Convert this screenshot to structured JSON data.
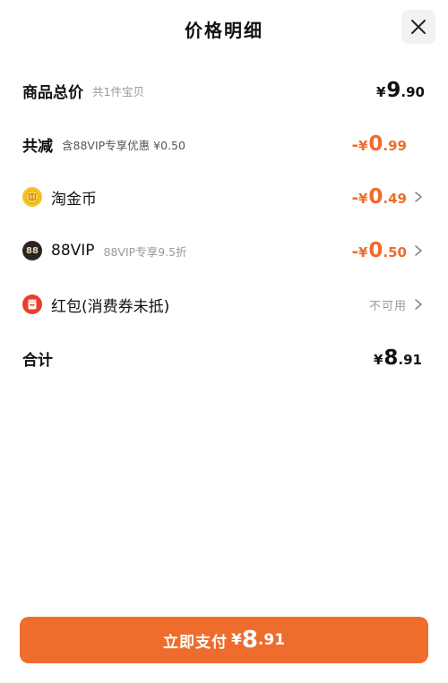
{
  "header": {
    "title": "价格明细",
    "close_icon": "close-icon"
  },
  "rows": {
    "goods_total": {
      "label": "商品总价",
      "sub": "共1件宝贝",
      "price_yen": "¥",
      "price_int": "9",
      "price_dec": ".90"
    },
    "total_discount": {
      "label": "共减",
      "sub": "含88VIP专享优惠 ¥0.50",
      "price_sign": "-",
      "price_yen": "¥",
      "price_int": "0",
      "price_dec": ".99"
    },
    "taojinbi": {
      "icon": "gold-coin-icon",
      "label": "淘金币",
      "price_sign": "-",
      "price_yen": "¥",
      "price_int": "0",
      "price_dec": ".49"
    },
    "vip": {
      "icon": "88vip-icon",
      "icon_text": "88",
      "label": "88VIP",
      "sub": "88VIP专享9.5折",
      "price_sign": "-",
      "price_yen": "¥",
      "price_int": "0",
      "price_dec": ".50"
    },
    "hongbao": {
      "icon": "red-envelope-icon",
      "label": "红包(消费券未抵)",
      "status": "不可用"
    },
    "sum": {
      "label": "合计",
      "price_yen": "¥",
      "price_int": "8",
      "price_dec": ".91"
    }
  },
  "pay_button": {
    "label": "立即支付",
    "price_yen": "¥",
    "price_int": "8",
    "price_dec": ".91"
  },
  "colors": {
    "accent": "#ee6d2c",
    "muted": "#999999",
    "text": "#111111"
  }
}
